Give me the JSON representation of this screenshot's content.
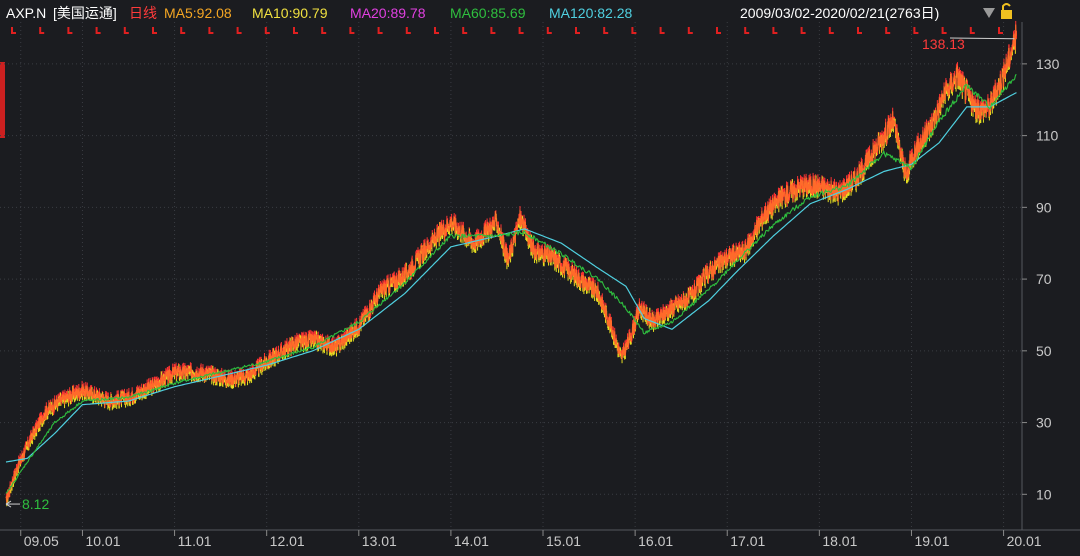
{
  "header": {
    "symbol": "AXP.N",
    "name": "[美国运通]",
    "period": "日线",
    "range": "2009/03/02-2020/02/21(2763日)",
    "ma": [
      {
        "label": "MA5:92.08",
        "color": "#f5a623"
      },
      {
        "label": "MA10:90.79",
        "color": "#f0e040"
      },
      {
        "label": "MA20:89.78",
        "color": "#e040e0"
      },
      {
        "label": "MA60:85.69",
        "color": "#2fbf3f"
      },
      {
        "label": "MA120:82.28",
        "color": "#4fd0e0"
      }
    ]
  },
  "colors": {
    "background": "#1b1c20",
    "grid": "#3a3c42",
    "up": "#ff3333",
    "down": "#e8e020",
    "price": "#ff6a2a",
    "ma_long": "#4fd0e0",
    "ma_mid": "#2fbf3f",
    "text": "#c9c9c9",
    "title": "#ffffff",
    "period": "#ff3b3b",
    "high_annot": "#ff3b3b",
    "low_annot": "#2fbf3f"
  },
  "chart_data": {
    "type": "line",
    "yticks": [
      10,
      30,
      50,
      70,
      90,
      110,
      130
    ],
    "ylim": [
      2,
      140
    ],
    "xlabels": [
      "09.05",
      "10.01",
      "11.01",
      "12.01",
      "13.01",
      "14.01",
      "15.01",
      "16.01",
      "17.01",
      "18.01",
      "19.01",
      "20.01"
    ],
    "xlabel_t": [
      2009.33,
      2010.0,
      2011.0,
      2012.0,
      2013.0,
      2014.0,
      2015.0,
      2016.0,
      2017.0,
      2018.0,
      2019.0,
      2020.0
    ],
    "xlim": [
      2009.17,
      2020.2
    ],
    "max_annotation": "138.13",
    "min_annotation": "8.12",
    "series": [
      {
        "role": "price",
        "x": [
          2009.17,
          2009.3,
          2009.45,
          2009.6,
          2009.75,
          2010.0,
          2010.3,
          2010.5,
          2010.75,
          2011.0,
          2011.3,
          2011.6,
          2011.8,
          2012.0,
          2012.3,
          2012.5,
          2012.75,
          2013.0,
          2013.25,
          2013.5,
          2013.75,
          2014.0,
          2014.25,
          2014.5,
          2014.62,
          2014.75,
          2014.9,
          2015.1,
          2015.4,
          2015.6,
          2015.75,
          2015.85,
          2015.95,
          2016.05,
          2016.2,
          2016.4,
          2016.6,
          2016.8,
          2017.0,
          2017.2,
          2017.4,
          2017.6,
          2017.8,
          2018.0,
          2018.2,
          2018.4,
          2018.6,
          2018.8,
          2018.95,
          2019.0,
          2019.2,
          2019.35,
          2019.5,
          2019.7,
          2019.85,
          2020.0,
          2020.14
        ],
        "values": [
          8.12,
          18,
          26,
          33,
          36,
          39,
          36,
          37,
          40,
          44,
          44,
          42,
          43,
          47,
          52,
          53,
          51,
          57,
          67,
          71,
          79,
          86,
          80,
          86,
          75,
          87,
          78,
          76,
          70,
          66,
          56,
          48,
          54,
          62,
          58,
          62,
          65,
          72,
          76,
          78,
          88,
          93,
          96,
          96,
          94,
          98,
          106,
          114,
          98,
          104,
          112,
          121,
          127,
          117,
          118,
          127,
          138.13
        ]
      },
      {
        "role": "ma_long",
        "x": [
          2009.17,
          2009.4,
          2009.7,
          2010.0,
          2010.5,
          2011.0,
          2011.5,
          2012.0,
          2012.5,
          2013.0,
          2013.5,
          2014.0,
          2014.5,
          2014.8,
          2015.2,
          2015.6,
          2015.9,
          2016.1,
          2016.4,
          2016.8,
          2017.1,
          2017.5,
          2017.9,
          2018.3,
          2018.7,
          2019.0,
          2019.3,
          2019.6,
          2019.85,
          2020.14
        ],
        "values": [
          19,
          20,
          27,
          35,
          36,
          40,
          43,
          46,
          50,
          56,
          66,
          79,
          82,
          84,
          80,
          73,
          68,
          59,
          56,
          64,
          72,
          82,
          91,
          95,
          100,
          102,
          108,
          118,
          118,
          122
        ]
      },
      {
        "role": "ma_mid",
        "x": [
          2009.17,
          2009.4,
          2009.7,
          2010.0,
          2010.5,
          2011.0,
          2011.5,
          2012.0,
          2012.5,
          2013.0,
          2013.5,
          2014.0,
          2014.5,
          2014.8,
          2015.2,
          2015.6,
          2015.9,
          2016.1,
          2016.4,
          2016.8,
          2017.1,
          2017.5,
          2017.9,
          2018.3,
          2018.7,
          2019.0,
          2019.3,
          2019.6,
          2019.85,
          2020.14
        ],
        "values": [
          10,
          19,
          30,
          36,
          37,
          41,
          44,
          47,
          51,
          58,
          69,
          82,
          82,
          83,
          77,
          70,
          62,
          55,
          58,
          67,
          75,
          85,
          93,
          96,
          105,
          101,
          114,
          124,
          118,
          127
        ]
      }
    ]
  }
}
